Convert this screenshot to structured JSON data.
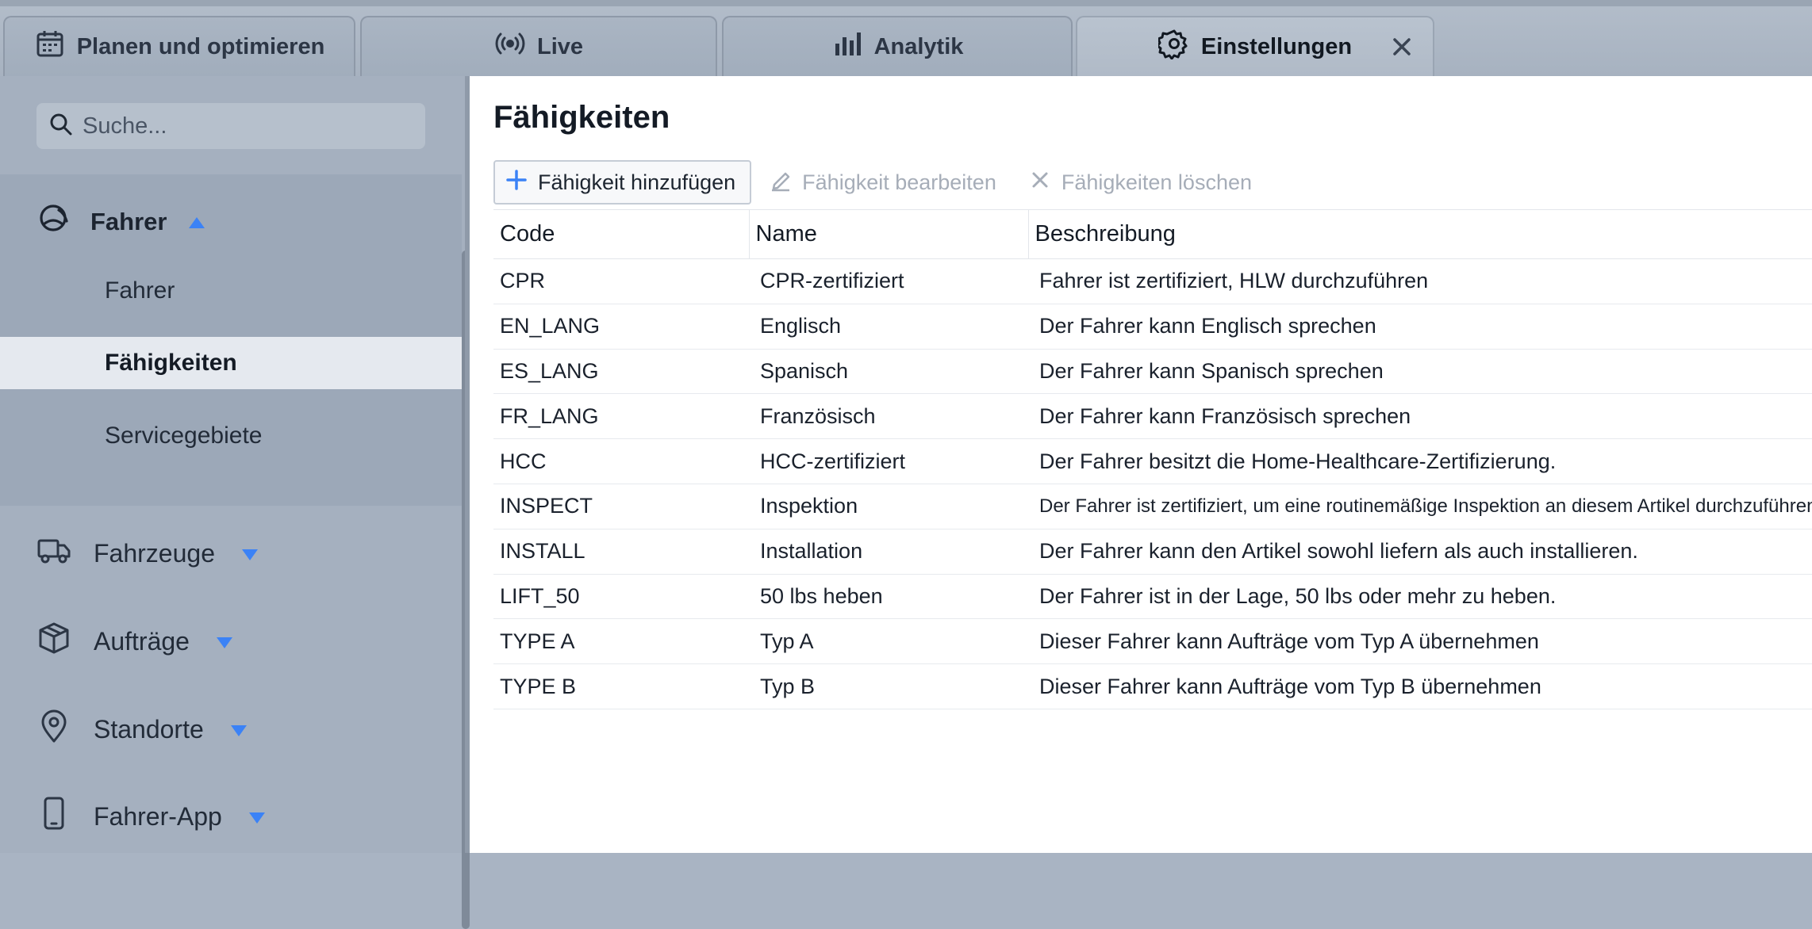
{
  "tabs": [
    {
      "label": "Planen und optimieren",
      "icon": "calendar-icon"
    },
    {
      "label": "Live",
      "icon": "broadcast-icon"
    },
    {
      "label": "Analytik",
      "icon": "bar-chart-icon"
    },
    {
      "label": "Einstellungen",
      "icon": "gear-icon",
      "active": true,
      "closable": true
    }
  ],
  "sidebar": {
    "search_placeholder": "Suche...",
    "group": {
      "label": "Fahrer",
      "icon": "driver-icon",
      "expanded": true,
      "items": [
        {
          "label": "Fahrer"
        },
        {
          "label": "Fähigkeiten",
          "selected": true
        },
        {
          "label": "Servicegebiete"
        }
      ]
    },
    "nav": [
      {
        "label": "Fahrzeuge",
        "icon": "truck-icon"
      },
      {
        "label": "Aufträge",
        "icon": "box-icon"
      },
      {
        "label": "Standorte",
        "icon": "map-pin-icon"
      },
      {
        "label": "Fahrer-App",
        "icon": "smartphone-icon"
      }
    ]
  },
  "main": {
    "title": "Fähigkeiten",
    "toolbar": {
      "add_label": "Fähigkeit hinzufügen",
      "edit_label": "Fähigkeit bearbeiten",
      "delete_label": "Fähigkeiten löschen"
    },
    "table": {
      "headers": [
        "Code",
        "Name",
        "Beschreibung"
      ],
      "rows": [
        {
          "code": "CPR",
          "name": "CPR-zertifiziert",
          "desc": "Fahrer ist zertifiziert, HLW durchzuführen"
        },
        {
          "code": "EN_LANG",
          "name": "Englisch",
          "desc": "Der Fahrer kann Englisch sprechen"
        },
        {
          "code": "ES_LANG",
          "name": "Spanisch",
          "desc": "Der Fahrer kann Spanisch sprechen"
        },
        {
          "code": "FR_LANG",
          "name": "Französisch",
          "desc": "Der Fahrer kann Französisch sprechen"
        },
        {
          "code": "HCC",
          "name": "HCC-zertifiziert",
          "desc": "Der Fahrer besitzt die Home-Healthcare-Zertifizierung."
        },
        {
          "code": "INSPECT",
          "name": "Inspektion",
          "desc": "Der Fahrer ist zertifiziert, um eine routinemäßige Inspektion an diesem Artikel durchzuführen."
        },
        {
          "code": "INSTALL",
          "name": "Installation",
          "desc": "Der Fahrer kann den Artikel sowohl liefern als auch installieren."
        },
        {
          "code": "LIFT_50",
          "name": "50 lbs heben",
          "desc": "Der Fahrer ist in der Lage, 50 lbs oder mehr zu heben."
        },
        {
          "code": "TYPE A",
          "name": "Typ A",
          "desc": "Dieser Fahrer kann Aufträge vom Typ A übernehmen"
        },
        {
          "code": "TYPE B",
          "name": "Typ B",
          "desc": "Dieser Fahrer kann Aufträge vom Typ B übernehmen"
        }
      ]
    }
  },
  "colors": {
    "accent": "#3b82f6",
    "chrome": "#a5b0bf",
    "selected_row": "#e5e9ef"
  }
}
